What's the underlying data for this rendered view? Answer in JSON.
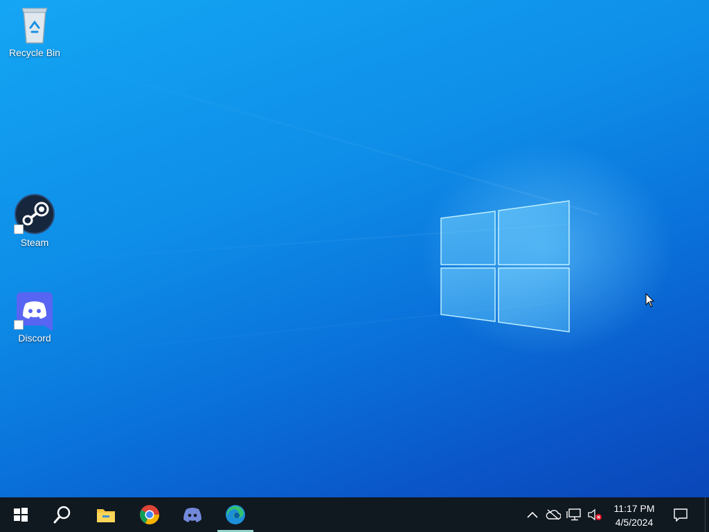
{
  "desktop": {
    "wallpaper": "windows-10-hero",
    "accent_color": "#0a73db",
    "icons": [
      {
        "label": "Recycle Bin",
        "icon": "recycle-bin-icon"
      },
      {
        "label": "Steam",
        "icon": "steam-icon",
        "shortcut": true
      },
      {
        "label": "Discord",
        "icon": "discord-icon",
        "shortcut": true
      }
    ]
  },
  "taskbar": {
    "background": "#101820",
    "buttons": [
      {
        "name": "start",
        "icon": "windows-icon"
      },
      {
        "name": "search",
        "icon": "search-icon"
      },
      {
        "name": "file-explorer",
        "icon": "folder-icon"
      },
      {
        "name": "chrome",
        "icon": "chrome-icon"
      },
      {
        "name": "discord",
        "icon": "discord-icon"
      },
      {
        "name": "edge",
        "icon": "edge-icon",
        "active": true
      }
    ],
    "tray": {
      "icons": [
        "chevron-up-icon",
        "onedrive-offline-icon",
        "network-icon",
        "volume-muted-icon"
      ],
      "time": "11:17 PM",
      "date": "4/5/2024",
      "notifications_icon": "action-center-icon"
    }
  }
}
